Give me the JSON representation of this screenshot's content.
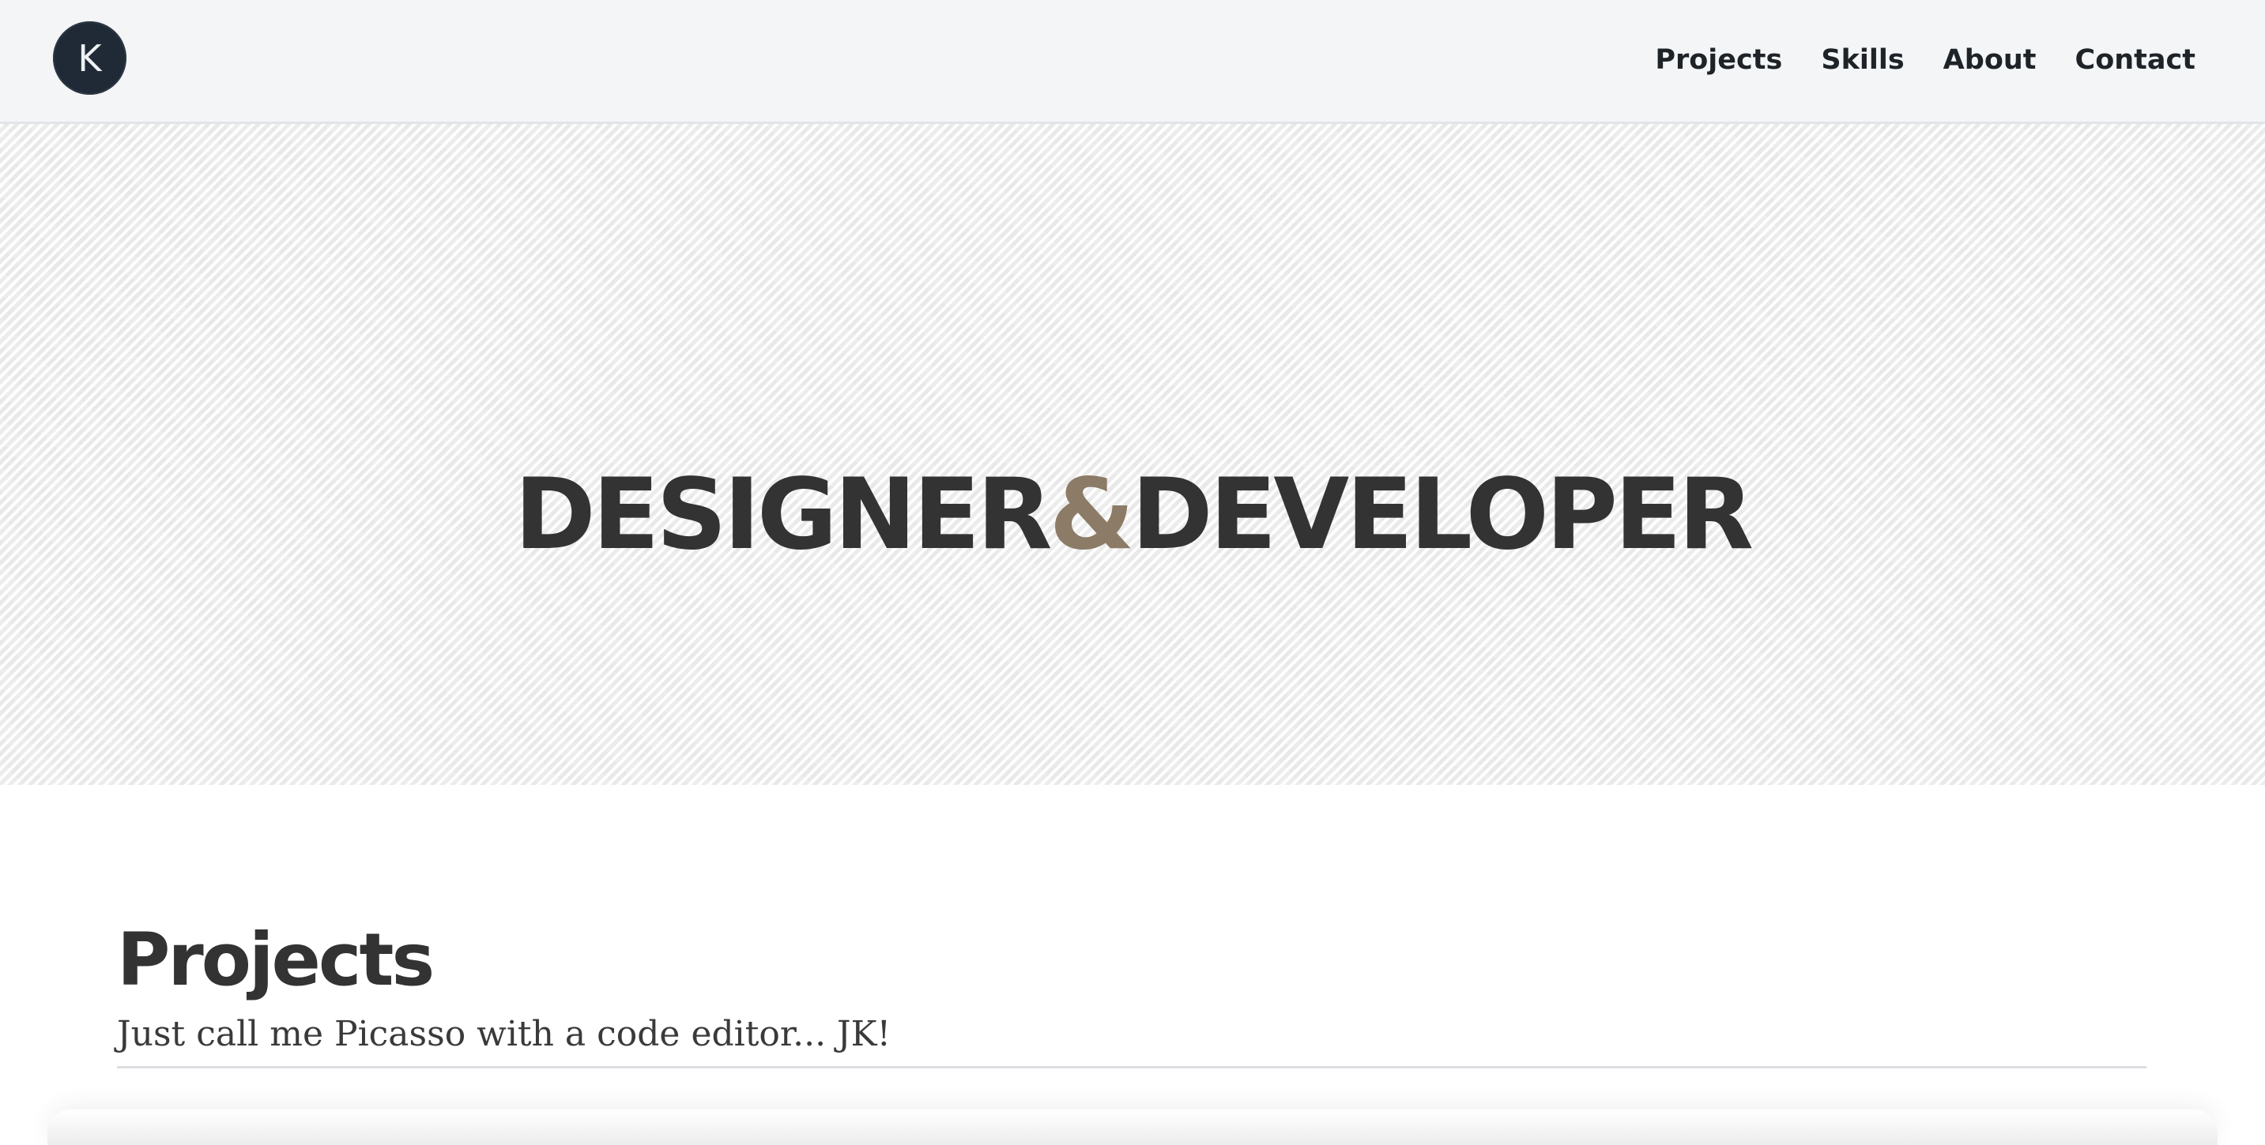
{
  "navbar": {
    "logo_letter": "K",
    "links": [
      {
        "label": "Projects"
      },
      {
        "label": "Skills"
      },
      {
        "label": "About"
      },
      {
        "label": "Contact"
      }
    ]
  },
  "hero": {
    "title_part1": "DESIGNER",
    "title_amp": "&",
    "title_part2": "DEVELOPER",
    "accent_color": "#8c7b67"
  },
  "projects_section": {
    "heading": "Projects",
    "subtitle": "Just call me Picasso with a code editor... JK!"
  }
}
